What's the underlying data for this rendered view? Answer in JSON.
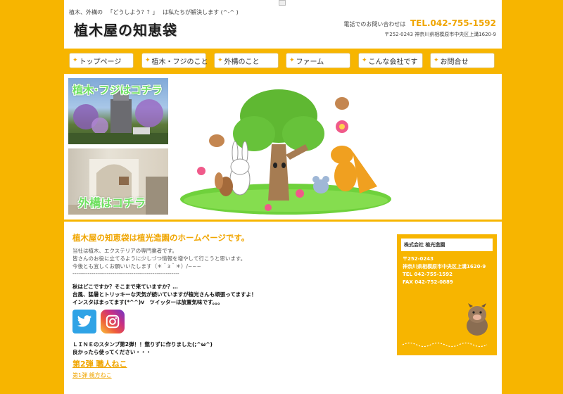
{
  "header": {
    "tagline_prefix": "植木、外構の",
    "tagline_quote": "「どうしよう？？」",
    "tagline_suffix": "は私たちが解決します (^-^ )",
    "logo": "植木屋の知恵袋",
    "contact_label": "電話でのお問い合わせは",
    "phone": "TEL.042-755-1592",
    "address": "〒252-0243 神奈川県相模原市中央区上溝1620-9"
  },
  "nav": {
    "items": [
      {
        "label": "トップページ"
      },
      {
        "label": "植木・フジのこと"
      },
      {
        "label": "外構のこと"
      },
      {
        "label": "ファーム"
      },
      {
        "label": "こんな会社です"
      },
      {
        "label": "お問合せ"
      }
    ]
  },
  "banners": {
    "wisteria": "植木･フジはコチラ",
    "exterior": "外構はコチラ"
  },
  "main": {
    "title": "植木屋の知恵袋は植光造園のホームページです。",
    "intro_1": "当社は植木、エクステリアの専門業者です。",
    "intro_2": "皆さんのお役に立てるように少しづつ情報を増やして行こうと思います。",
    "intro_3": "今後とも宜しくお願いいたします（＊＾з＾＊）/~~~",
    "separator": "--------------------------------------------------------",
    "news_1": "秋はどこですか？そこまで来ていますか？…",
    "news_2": "台風、猛暑とトリッキーな天気が続いていますが植光さんも頑張ってますよ！",
    "news_3": "インスタはまってます(*^^)v　ツイッターは放置気味です。。。",
    "line_1": "ＬＩＮＥのスタンプ第2弾！！懲りずに作りました(;^ω^)",
    "line_2": "良かったら使ってください・・・",
    "link_2": "第2弾 職人ねこ",
    "link_1": "第1弾 親方ねこ"
  },
  "company": {
    "name": "株式会社 植光造園",
    "postal": "〒252-0243",
    "address": "神奈川県相模原市中央区上溝1620-9",
    "tel": "TEL 042-755-1592",
    "fax": "FAX 042-752-0889"
  },
  "colors": {
    "accent": "#f7b500",
    "link": "#f0a500",
    "banner_text": "#6ee060"
  },
  "icons": [
    "twitter-icon",
    "instagram-icon",
    "arrow-icon",
    "boar-mascot"
  ]
}
